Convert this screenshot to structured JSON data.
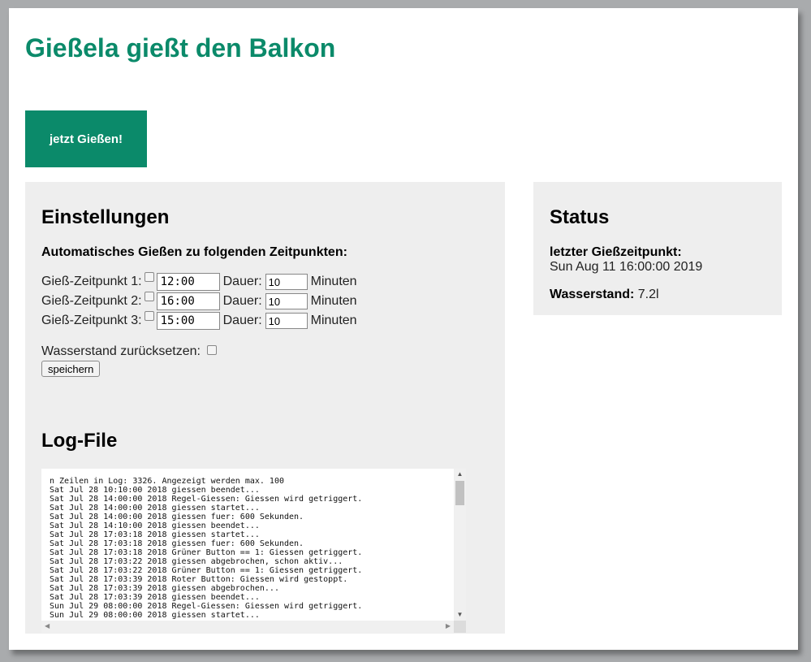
{
  "header": {
    "title": "Gießela gießt den Balkon"
  },
  "actions": {
    "water_now": "jetzt Gießen!"
  },
  "settings": {
    "heading": "Einstellungen",
    "subheading": "Automatisches Gießen zu folgenden Zeitpunkten:",
    "slots": [
      {
        "label": "Gieß-Zeitpunkt 1:",
        "time": "12:00",
        "duration_label": "Dauer:",
        "duration": "10",
        "unit": "Minuten"
      },
      {
        "label": "Gieß-Zeitpunkt 2:",
        "time": "16:00",
        "duration_label": "Dauer:",
        "duration": "10",
        "unit": "Minuten"
      },
      {
        "label": "Gieß-Zeitpunkt 3:",
        "time": "15:00",
        "duration_label": "Dauer:",
        "duration": "10",
        "unit": "Minuten"
      }
    ],
    "reset_label": "Wasserstand zurücksetzen:",
    "save_label": "speichern"
  },
  "log": {
    "heading": "Log-File",
    "lines": [
      "n Zeilen in Log: 3326. Angezeigt werden max. 100",
      "Sat Jul 28 10:10:00 2018 giessen beendet...",
      "Sat Jul 28 14:00:00 2018 Regel-Giessen: Giessen wird getriggert.",
      "Sat Jul 28 14:00:00 2018 giessen startet...",
      "Sat Jul 28 14:00:00 2018 giessen fuer: 600 Sekunden.",
      "Sat Jul 28 14:10:00 2018 giessen beendet...",
      "Sat Jul 28 17:03:18 2018 giessen startet...",
      "Sat Jul 28 17:03:18 2018 giessen fuer: 600 Sekunden.",
      "Sat Jul 28 17:03:18 2018 Grüner Button == 1: Giessen getriggert.",
      "Sat Jul 28 17:03:22 2018 giessen abgebrochen, schon aktiv...",
      "Sat Jul 28 17:03:22 2018 Grüner Button == 1: Giessen getriggert.",
      "Sat Jul 28 17:03:39 2018 Roter Button: Giessen wird gestoppt.",
      "Sat Jul 28 17:03:39 2018 giessen abgebrochen...",
      "Sat Jul 28 17:03:39 2018 giessen beendet...",
      "Sun Jul 29 08:00:00 2018 Regel-Giessen: Giessen wird getriggert.",
      "Sun Jul 29 08:00:00 2018 giessen startet..."
    ]
  },
  "status": {
    "heading": "Status",
    "last_watering_label": "letzter Gießzeitpunkt:",
    "last_watering_value": "Sun Aug 11 16:00:00 2019",
    "water_level_label": "Wasserstand:",
    "water_level_value": "7.2l"
  },
  "colors": {
    "accent": "#0b8a6a",
    "panel": "#eeeeee",
    "backdrop": "#a9abad"
  }
}
